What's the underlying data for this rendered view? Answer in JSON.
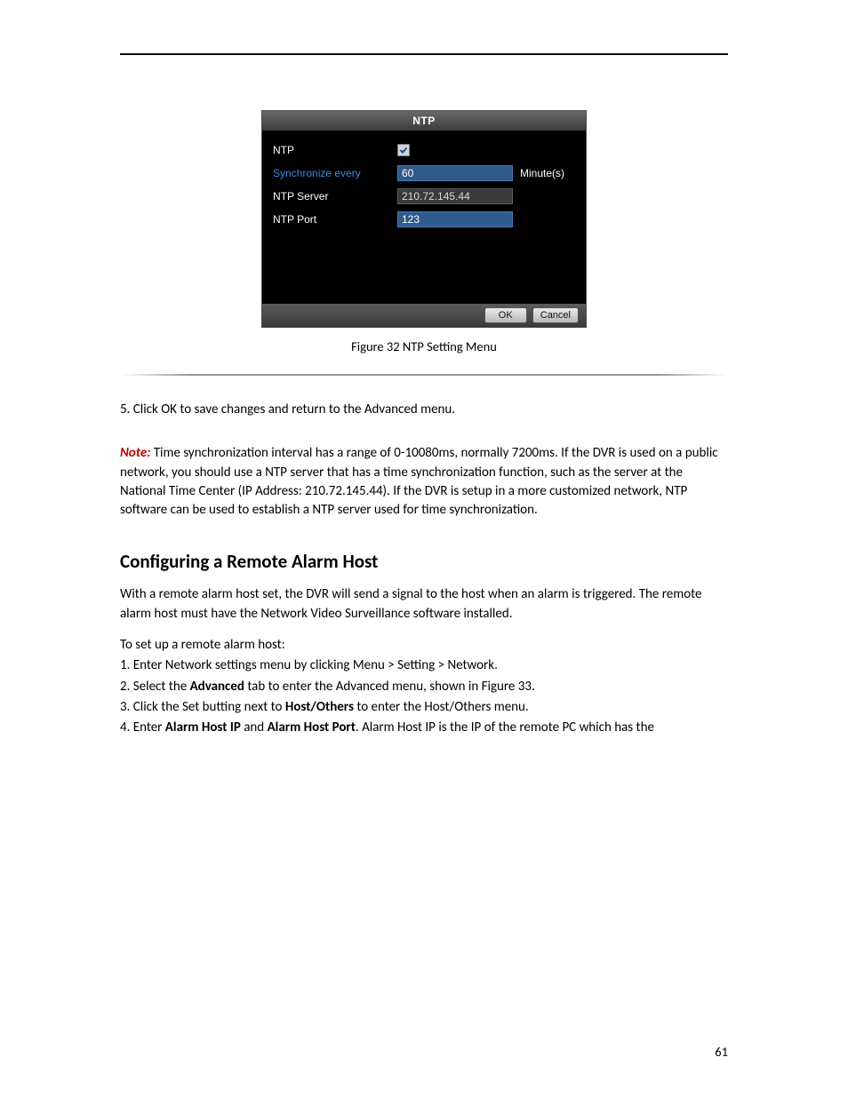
{
  "dialog": {
    "title": "NTP",
    "rows": {
      "ntp_label": "NTP",
      "sync_label": "Synchronize every",
      "sync_value": "60",
      "sync_unit": "Minute(s)",
      "server_label": "NTP Server",
      "server_value": "210.72.145.44",
      "port_label": "NTP Port",
      "port_value": "123"
    },
    "buttons": {
      "ok": "OK",
      "cancel": "Cancel"
    }
  },
  "caption": "Figure 32 NTP Setting Menu",
  "para1": "5. Click OK to save changes and return to the Advanced menu.",
  "note_label": "Note:",
  "note_text": " Time synchronization interval has a range of 0-10080ms, normally 7200ms. If the DVR is used on a public network, you should use a NTP server that has a time synchronization function, such as the server at the National Time Center (IP Address: 210.72.145.44). If the DVR is setup in a more customized network, NTP software can be used to establish a NTP server used for time synchronization.",
  "heading": "Configuring a Remote Alarm Host",
  "para2": "With a remote alarm host set, the DVR will send a signal to the host when an alarm is triggered. The remote alarm host must have the Network Video Surveillance software installed.",
  "para3": "To set up a remote alarm host:",
  "steps": {
    "s1_a": "1. Enter Network settings menu by clicking Menu > Setting > Network.",
    "s2_a": "2. Select the ",
    "s2_b": "Advanced",
    "s2_c": " tab to enter the Advanced menu, shown in Figure 33.",
    "s3_a": "3. Click the Set butting next to ",
    "s3_b": "Host/Others",
    "s3_c": " to enter the Host/Others menu.",
    "s4_a": "4. Enter ",
    "s4_b": "Alarm Host IP",
    "s4_c": " and ",
    "s4_d": "Alarm Host Port",
    "s4_e": ". Alarm Host IP is the IP of the remote PC which has the"
  },
  "page_number": "61"
}
